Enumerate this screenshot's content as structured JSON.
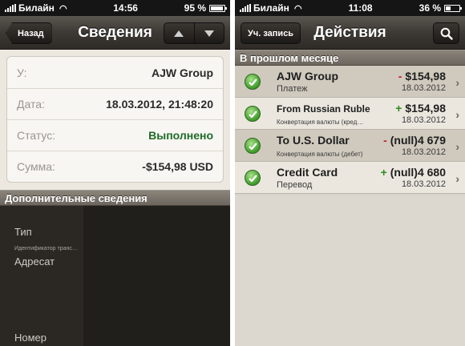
{
  "left": {
    "status": {
      "carrier": "Билайн",
      "time": "14:56",
      "battery": "95 %",
      "battery_level": 0.95
    },
    "nav": {
      "back": "Назад",
      "title": "Сведения",
      "up_icon": "arrow-up-icon",
      "down_icon": "arrow-down-icon"
    },
    "details": [
      {
        "label": "У:",
        "value": "AJW Group"
      },
      {
        "label": "Дата:",
        "value": "18.03.2012, 21:48:20"
      },
      {
        "label": "Статус:",
        "value": "Выполнено"
      },
      {
        "label": "Сумма:",
        "value": "-$154,98 USD"
      }
    ],
    "additional_header": "Дополнительные сведения",
    "additional": {
      "type": "Тип",
      "tx_id": "Идентификатор транс…",
      "recipient": "Адресат",
      "number": "Номер"
    },
    "colors": {
      "status_green": "#1f6b2a"
    }
  },
  "right": {
    "status": {
      "carrier": "Билайн",
      "time": "11:08",
      "battery": "36 %",
      "battery_level": 0.36
    },
    "nav": {
      "account": "Уч. запись",
      "title": "Действия",
      "search_icon": "search-icon"
    },
    "section": "В прошлом месяце",
    "transactions": [
      {
        "name": "AJW Group",
        "sub": "Платеж",
        "sign": "-",
        "amount": "$154,98",
        "date": "18.03.2012"
      },
      {
        "name": "From Russian Ruble",
        "sub": "Конвертация валюты (кред…",
        "sign": "+",
        "amount": "$154,98",
        "date": "18.03.2012"
      },
      {
        "name": "To U.S. Dollar",
        "sub": "Конвертация валюты (дебет)",
        "sign": "-",
        "amount": "(null)4 679",
        "date": "18.03.2012"
      },
      {
        "name": "Credit Card",
        "sub": "Перевод",
        "sign": "+",
        "amount": "(null)4 680",
        "date": "18.03.2012"
      }
    ],
    "colors": {
      "minus": "#c0201a",
      "plus": "#2e8b22"
    }
  }
}
